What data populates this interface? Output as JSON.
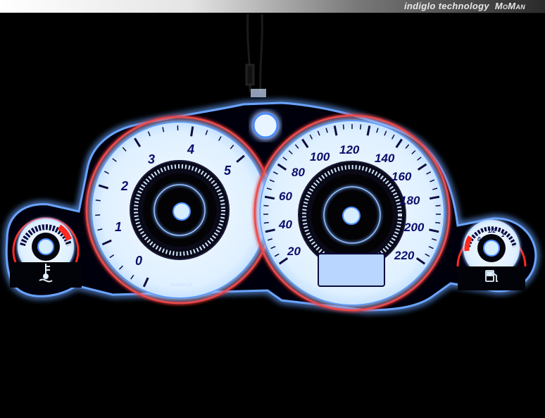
{
  "banner": {
    "text": "indiglo technology",
    "brand": "MoMan"
  },
  "tachometer": {
    "labels": [
      "0",
      "1",
      "2",
      "3",
      "4",
      "5"
    ],
    "maker_mark": "MoMan.pl"
  },
  "speedometer": {
    "labels": [
      "20",
      "40",
      "60",
      "80",
      "100",
      "120",
      "140",
      "160",
      "180",
      "200",
      "220"
    ]
  },
  "temperature_gauge": {
    "icon": "coolant-temperature-icon"
  },
  "fuel_gauge": {
    "labels": [
      "0",
      "1/2",
      "1"
    ],
    "icon": "fuel-pump-icon"
  },
  "colors": {
    "glow": "#3a78ff",
    "face": "#e9f5ff",
    "red_arc": "#ff2a1e",
    "numerals": "#0c0c6a"
  }
}
